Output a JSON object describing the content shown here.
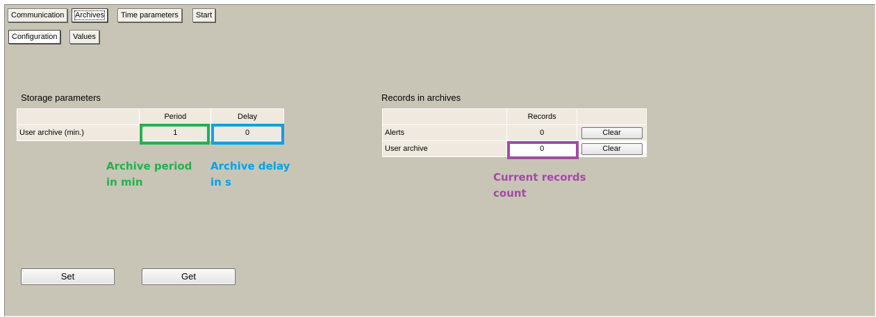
{
  "main_tabs": [
    "Communication",
    "Archives",
    "Time parameters",
    "Start"
  ],
  "sub_tabs": [
    "Configuration",
    "Values"
  ],
  "storage": {
    "title": "Storage parameters",
    "headers": [
      "",
      "Period",
      "Delay"
    ],
    "row_label": "User archive (min.)",
    "period": "1",
    "delay": "0"
  },
  "records": {
    "title": "Records in archives",
    "headers": [
      "",
      "Records",
      ""
    ],
    "rows": [
      {
        "label": "Alerts",
        "count": "0",
        "button": "Clear"
      },
      {
        "label": "User archive",
        "count": "0",
        "button": "Clear"
      }
    ]
  },
  "annotations": {
    "period_note": "Archive period\nin min",
    "delay_note": "Archive delay\nin s",
    "records_note": "Current records\ncount",
    "colors": {
      "period": "#22b14c",
      "delay": "#00a2e8",
      "records": "#a349a4"
    }
  },
  "buttons": {
    "set": "Set",
    "get": "Get"
  }
}
